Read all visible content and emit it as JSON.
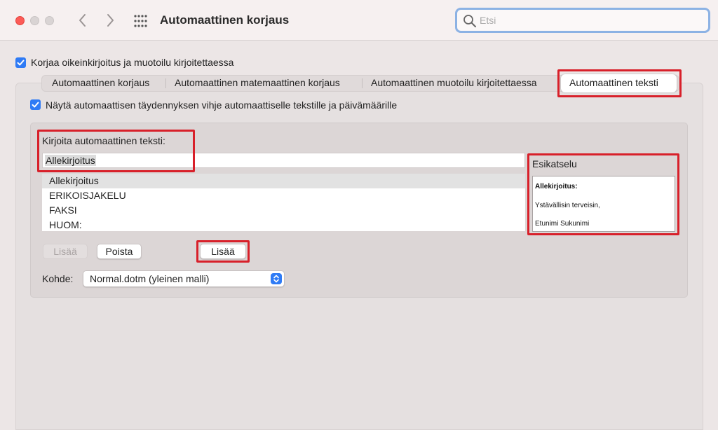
{
  "window": {
    "title": "Automaattinen korjaus",
    "search_placeholder": "Etsi"
  },
  "main": {
    "correct_spelling_label": "Korjaa oikeinkirjoitus ja muotoilu kirjoitettaessa",
    "correct_spelling_checked": true
  },
  "tabs": [
    {
      "label": "Automaattinen korjaus",
      "selected": false
    },
    {
      "label": "Automaattinen matemaattinen korjaus",
      "selected": false
    },
    {
      "label": "Automaattinen muotoilu kirjoitettaessa",
      "selected": false
    },
    {
      "label": "Automaattinen teksti",
      "selected": true
    }
  ],
  "autotext": {
    "show_tip_label": "Näytä automaattisen täydennyksen vihje automaattiselle tekstille ja päivämäärille",
    "show_tip_checked": true,
    "enter_label": "Kirjoita automaattinen teksti:",
    "entry_value": "Allekirjoitus",
    "items": [
      {
        "label": "Allekirjoitus",
        "selected": true
      },
      {
        "label": "ERIKOISJAKELU",
        "selected": false
      },
      {
        "label": "FAKSI",
        "selected": false
      },
      {
        "label": "HUOM:",
        "selected": false
      }
    ],
    "preview_label": "Esikatselu",
    "preview_lines": [
      "Allekirjoitus:",
      "Ystävällisin terveisin,",
      "Etunimi Sukunimi"
    ],
    "add_disabled_label": "Lisää",
    "delete_label": "Poista",
    "add_label": "Lisää",
    "target_label": "Kohde:",
    "target_value": "Normal.dotm (yleinen malli)"
  },
  "colors": {
    "accent": "#2f7bf5",
    "highlight_box": "#d8202a",
    "close_button": "#fc5b57"
  }
}
